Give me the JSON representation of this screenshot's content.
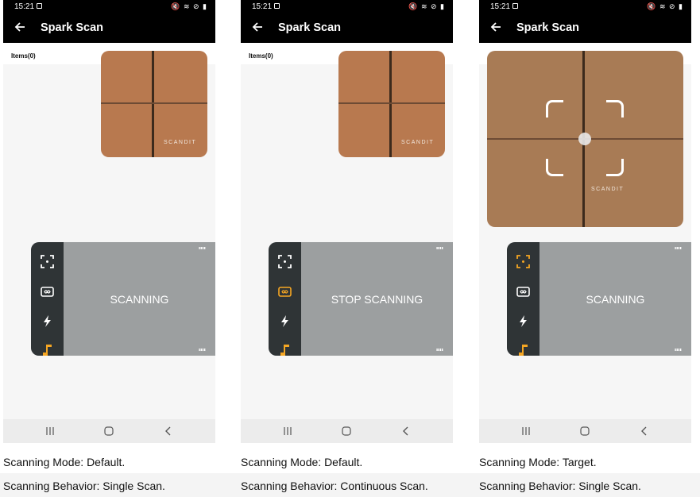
{
  "app": {
    "title": "Spark Scan",
    "items_label": "Items(0)",
    "watermark": "SCANDIT"
  },
  "statusbar": {
    "time": "15:21",
    "indicators": "🔇 ≋ ⊘ ▮"
  },
  "screens": [
    {
      "trigger_label": "SCANNING",
      "active_tool": "none",
      "accent": "#f5a623"
    },
    {
      "trigger_label": "STOP SCANNING",
      "active_tool": "continuous-mode",
      "accent": "#f5a623"
    },
    {
      "trigger_label": "SCANNING",
      "active_tool": "target-mode",
      "accent": "#f5a623"
    }
  ],
  "captions": [
    {
      "mode": "Scanning Mode: Default.",
      "behavior": "Scanning Behavior: Single Scan."
    },
    {
      "mode": "Scanning Mode: Default.",
      "behavior": "Scanning Behavior: Continuous Scan."
    },
    {
      "mode": "Scanning Mode: Target.",
      "behavior": "Scanning Behavior: Single Scan."
    }
  ],
  "icons": [
    "arrow-left-icon",
    "target-mode-icon",
    "continuous-scan-icon",
    "flash-icon",
    "sound-icon",
    "recents-icon",
    "home-icon",
    "back-icon"
  ]
}
